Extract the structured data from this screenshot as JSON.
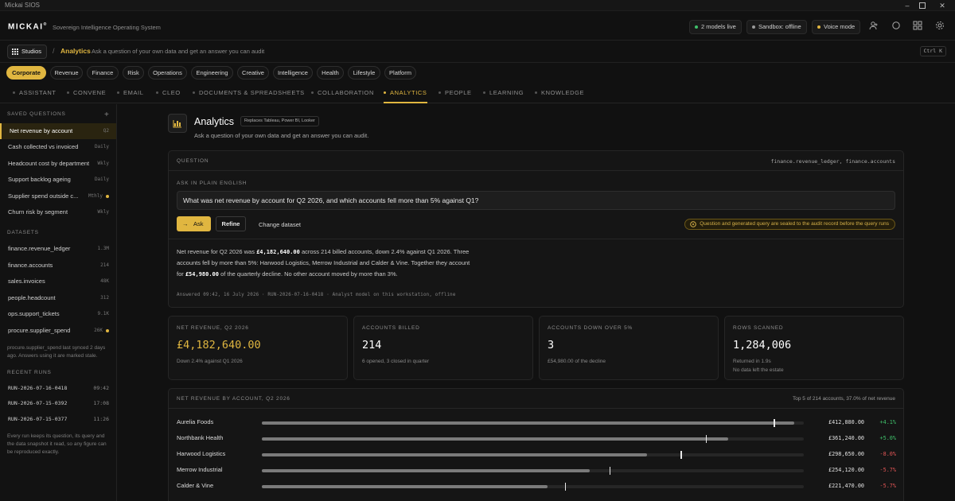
{
  "window": {
    "title": "Mickai SIOS"
  },
  "header": {
    "logo": "MICKAI",
    "logo_mark": "®",
    "tagline": "Sovereign Intelligence Operating System",
    "status": [
      {
        "label": "2 models live",
        "color": "#3fbf6a"
      },
      {
        "label": "Sandbox: offline",
        "color": "#9a9a9a"
      },
      {
        "label": "Voice mode",
        "color": "#e0b640"
      }
    ]
  },
  "breadcrumb": {
    "studios_label": "Studios",
    "current": "Analytics",
    "description": "Ask a question of your own data and get an answer you can audit",
    "shortcut": "Ctrl K"
  },
  "categories": [
    {
      "label": "Corporate",
      "active": true
    },
    {
      "label": "Revenue"
    },
    {
      "label": "Finance"
    },
    {
      "label": "Risk"
    },
    {
      "label": "Operations"
    },
    {
      "label": "Engineering"
    },
    {
      "label": "Creative"
    },
    {
      "label": "Intelligence"
    },
    {
      "label": "Health"
    },
    {
      "label": "Lifestyle"
    },
    {
      "label": "Platform"
    }
  ],
  "tabs": [
    {
      "label": "ASSISTANT"
    },
    {
      "label": "CONVENE"
    },
    {
      "label": "EMAIL"
    },
    {
      "label": "CLEO"
    },
    {
      "label": "DOCUMENTS & SPREADSHEETS"
    },
    {
      "label": "COLLABORATION"
    },
    {
      "label": "ANALYTICS",
      "active": true
    },
    {
      "label": "PEOPLE"
    },
    {
      "label": "LEARNING"
    },
    {
      "label": "KNOWLEDGE"
    }
  ],
  "sidebar": {
    "saved_heading": "SAVED QUESTIONS",
    "add_label": "+",
    "saved": [
      {
        "label": "Net revenue by account",
        "tag": "Q2",
        "active": true
      },
      {
        "label": "Cash collected vs invoiced",
        "tag": "Daily"
      },
      {
        "label": "Headcount cost by department",
        "tag": "Wkly"
      },
      {
        "label": "Support backlog ageing",
        "tag": "Daily"
      },
      {
        "label": "Supplier spend outside c...",
        "tag": "Mthly",
        "warning": true
      },
      {
        "label": "Churn risk by segment",
        "tag": "Wkly"
      }
    ],
    "datasets_heading": "DATASETS",
    "datasets": [
      {
        "label": "finance.revenue_ledger",
        "tag": "1.3M"
      },
      {
        "label": "finance.accounts",
        "tag": "214"
      },
      {
        "label": "sales.invoices",
        "tag": "48K"
      },
      {
        "label": "people.headcount",
        "tag": "312"
      },
      {
        "label": "ops.support_tickets",
        "tag": "9.1K"
      },
      {
        "label": "procure.supplier_spend",
        "tag": "26K",
        "warning": true
      }
    ],
    "stale_note": "procure.supplier_spend last synced 2 days ago. Answers using it are marked stale.",
    "runs_heading": "RECENT RUNS",
    "runs": [
      {
        "id": "RUN-2026-07-16-0418",
        "time": "09:42"
      },
      {
        "id": "RUN-2026-07-15-0392",
        "time": "17:08"
      },
      {
        "id": "RUN-2026-07-15-0377",
        "time": "11:26"
      }
    ],
    "runs_note": "Every run keeps its question, its query and the data snapshot it read, so any figure can be reproduced exactly."
  },
  "main": {
    "title": "Analytics",
    "badge": "Replaces Tableau, Power BI, Looker",
    "subtitle": "Ask a question of your own data and get an answer you can audit."
  },
  "question": {
    "heading": "QUESTION",
    "sources": "finance.revenue_ledger, finance.accounts",
    "ask_label": "ASK IN PLAIN ENGLISH",
    "value": "What was net revenue by account for Q2 2026, and which accounts fell more than 5% against Q1?",
    "ask_button": "Ask",
    "refine_button": "Refine",
    "change_dataset": "Change dataset",
    "seal_note": "Question and generated query are sealed to the audit record before the query runs",
    "answer": {
      "p1": "Net revenue for Q2 2026 was ",
      "v1": "£4,182,640.00",
      "p2": " across 214 billed accounts, down 2.4% against Q1 2026. Three accounts fell by more than 5%: Harwood Logistics, Merrow Industrial and Calder & Vine. Together they account for ",
      "v2": "£54,980.00",
      "p3": " of the quarterly decline. No other account moved by more than 3%."
    },
    "meta": "Answered 09:42, 16 July 2026 · RUN-2026-07-16-0418 · Analyst model on this workstation, offline"
  },
  "kpis": [
    {
      "heading": "NET REVENUE, Q2 2026",
      "value": "£4,182,640.00",
      "sub": "Down 2.4% against Q1 2026",
      "gold": true
    },
    {
      "heading": "ACCOUNTS BILLED",
      "value": "214",
      "sub": "6 opened, 3 closed in quarter"
    },
    {
      "heading": "ACCOUNTS DOWN OVER 5%",
      "value": "3",
      "sub": "£54,980.00 of the decline"
    },
    {
      "heading": "ROWS SCANNED",
      "value": "1,284,006",
      "sub": "Returned in 1.9s\nNo data left the estate"
    }
  ],
  "chart_data": {
    "type": "bar",
    "title": "NET REVENUE BY ACCOUNT, Q2 2026",
    "summary": "Top 5 of 214 accounts, 37.0% of net revenue",
    "categories": [
      "Aurelia Foods",
      "Northbank Health",
      "Harwood Logistics",
      "Merrow Industrial",
      "Calder & Vine"
    ],
    "values": [
      412880,
      361240,
      298650,
      254120,
      221470
    ],
    "value_labels": [
      "£412,880.00",
      "£361,240.00",
      "£298,650.00",
      "£254,120.00",
      "£221,470.00"
    ],
    "changes": [
      "+4.1%",
      "+5.0%",
      "-8.0%",
      "-5.7%",
      "-5.7%"
    ],
    "change_pct": [
      4.1,
      5.0,
      -8.0,
      -5.7,
      -5.7
    ],
    "scale_max": 420000,
    "colors": {
      "bar": "#7a7a7a",
      "up": "#3fbf6a",
      "down": "#e05555"
    }
  }
}
